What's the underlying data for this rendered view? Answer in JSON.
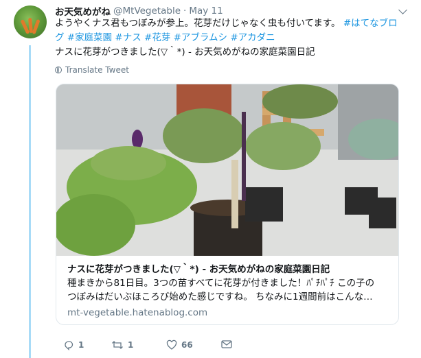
{
  "tweet": {
    "display_name": "お天気めがね",
    "handle": "@MtVegetable",
    "separator": "·",
    "date": "May 11",
    "line1_text": "ようやくナス君もつぼみが参上。花芽だけじゃなく虫も付いてます。",
    "line2_text": "ナスに花芽がつきました(▽｀*) - お天気めがねの家庭菜園日記",
    "hashtags": [
      "#はてなブログ",
      "#家庭菜園",
      "#ナス",
      "#花芽",
      "#アブラムシ",
      "#アカダニ"
    ],
    "translate_label": "Translate Tweet"
  },
  "card": {
    "title": "ナスに花芽がつきました(▽｀*) - お天気めがねの家庭菜園日記",
    "description_line1": "種まきから81日目。3つの苗すべてに花芽が付きました！ﾊﾟﾁﾊﾟﾁ この子の",
    "description_line2": "つぼみはだいぶほころび始めた感じですね。 ちなみに1週間前はこんな…",
    "domain": "mt-vegetable.hatenablog.com"
  },
  "actions": {
    "reply_icon": "reply-icon",
    "reply_count": "1",
    "retweet_icon": "retweet-icon",
    "retweet_count": "1",
    "like_icon": "heart-icon",
    "like_count": "66",
    "dm_icon": "message-icon"
  },
  "colors": {
    "link": "#1b95e0",
    "muted": "#657786",
    "thread_line": "#a8dbf7",
    "border": "#e1e8ed"
  }
}
